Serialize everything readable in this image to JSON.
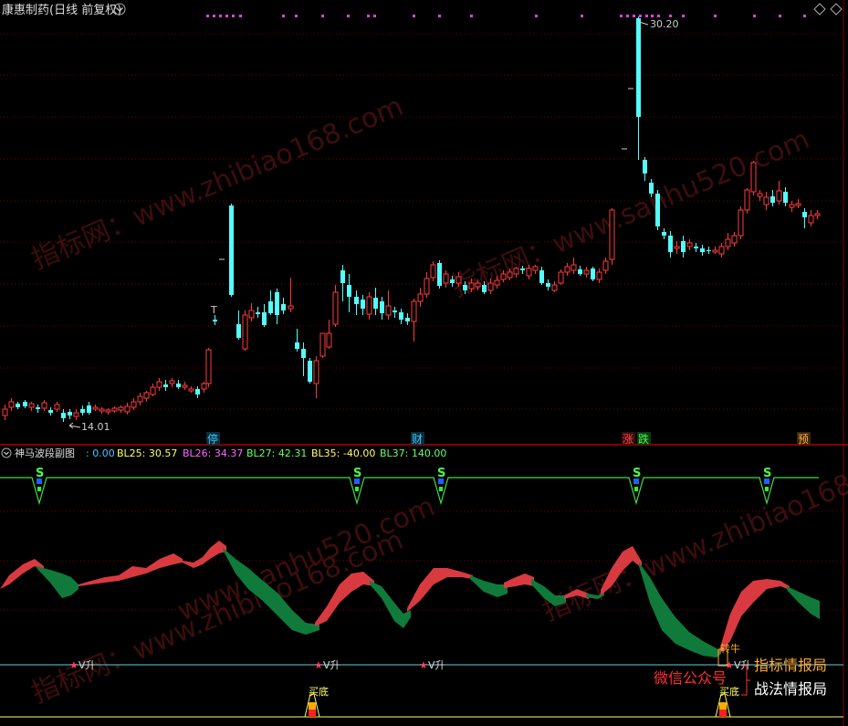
{
  "window": {
    "title": "康惠制药(日线 前复权)",
    "nav_up_icon": "triangle-up-icon",
    "nav_down_icon": "triangle-down-icon",
    "dropdown_icon": "chevron-down-icon"
  },
  "main_chart": {
    "high_label": "30.20",
    "low_label": "14.01",
    "t_label": "T",
    "event_tags": [
      {
        "text": "停",
        "color": "#35c6ff"
      },
      {
        "text": "财",
        "color": "#35c6ff"
      },
      {
        "text": "涨",
        "color": "#ff4444"
      },
      {
        "text": "跌",
        "color": "#44ff44"
      },
      {
        "text": "预",
        "color": "#ffaa33"
      }
    ]
  },
  "indicator": {
    "name": "神马波段副图",
    "values": [
      {
        "label": ": 0.00",
        "color": "#4fc3ff"
      },
      {
        "label": "BL25: 30.57",
        "color": "#ffff66"
      },
      {
        "label": "BL26: 34.37",
        "color": "#ff66ff"
      },
      {
        "label": "BL27: 42.31",
        "color": "#66ff66"
      },
      {
        "label": "BL35: -40.00",
        "color": "#ffff66"
      },
      {
        "label": "BL37: 140.00",
        "color": "#66ff66"
      }
    ],
    "s_label": "S",
    "v_label": "V升",
    "turn_label": "转牛",
    "buy_label": "买底"
  },
  "watermarks": {
    "cn": "指标网：www.zhibiao168.com",
    "cn2": "指标网：www.sanhu520.com",
    "mid": "www.sanhu520.com",
    "bottom": "www.zhibiao168.com"
  },
  "corner": {
    "wechat": "微信公众号",
    "line1": "指标情报局",
    "line2": "战法情报局"
  },
  "colors": {
    "up": "#ff3b3b",
    "down": "#54fcfc",
    "grid": "#7a0000",
    "green_band": "#0f7a3a",
    "red_band": "#d83a40"
  },
  "chart_data": {
    "type": "candlestick",
    "high": 30.2,
    "low": 14.01
  }
}
